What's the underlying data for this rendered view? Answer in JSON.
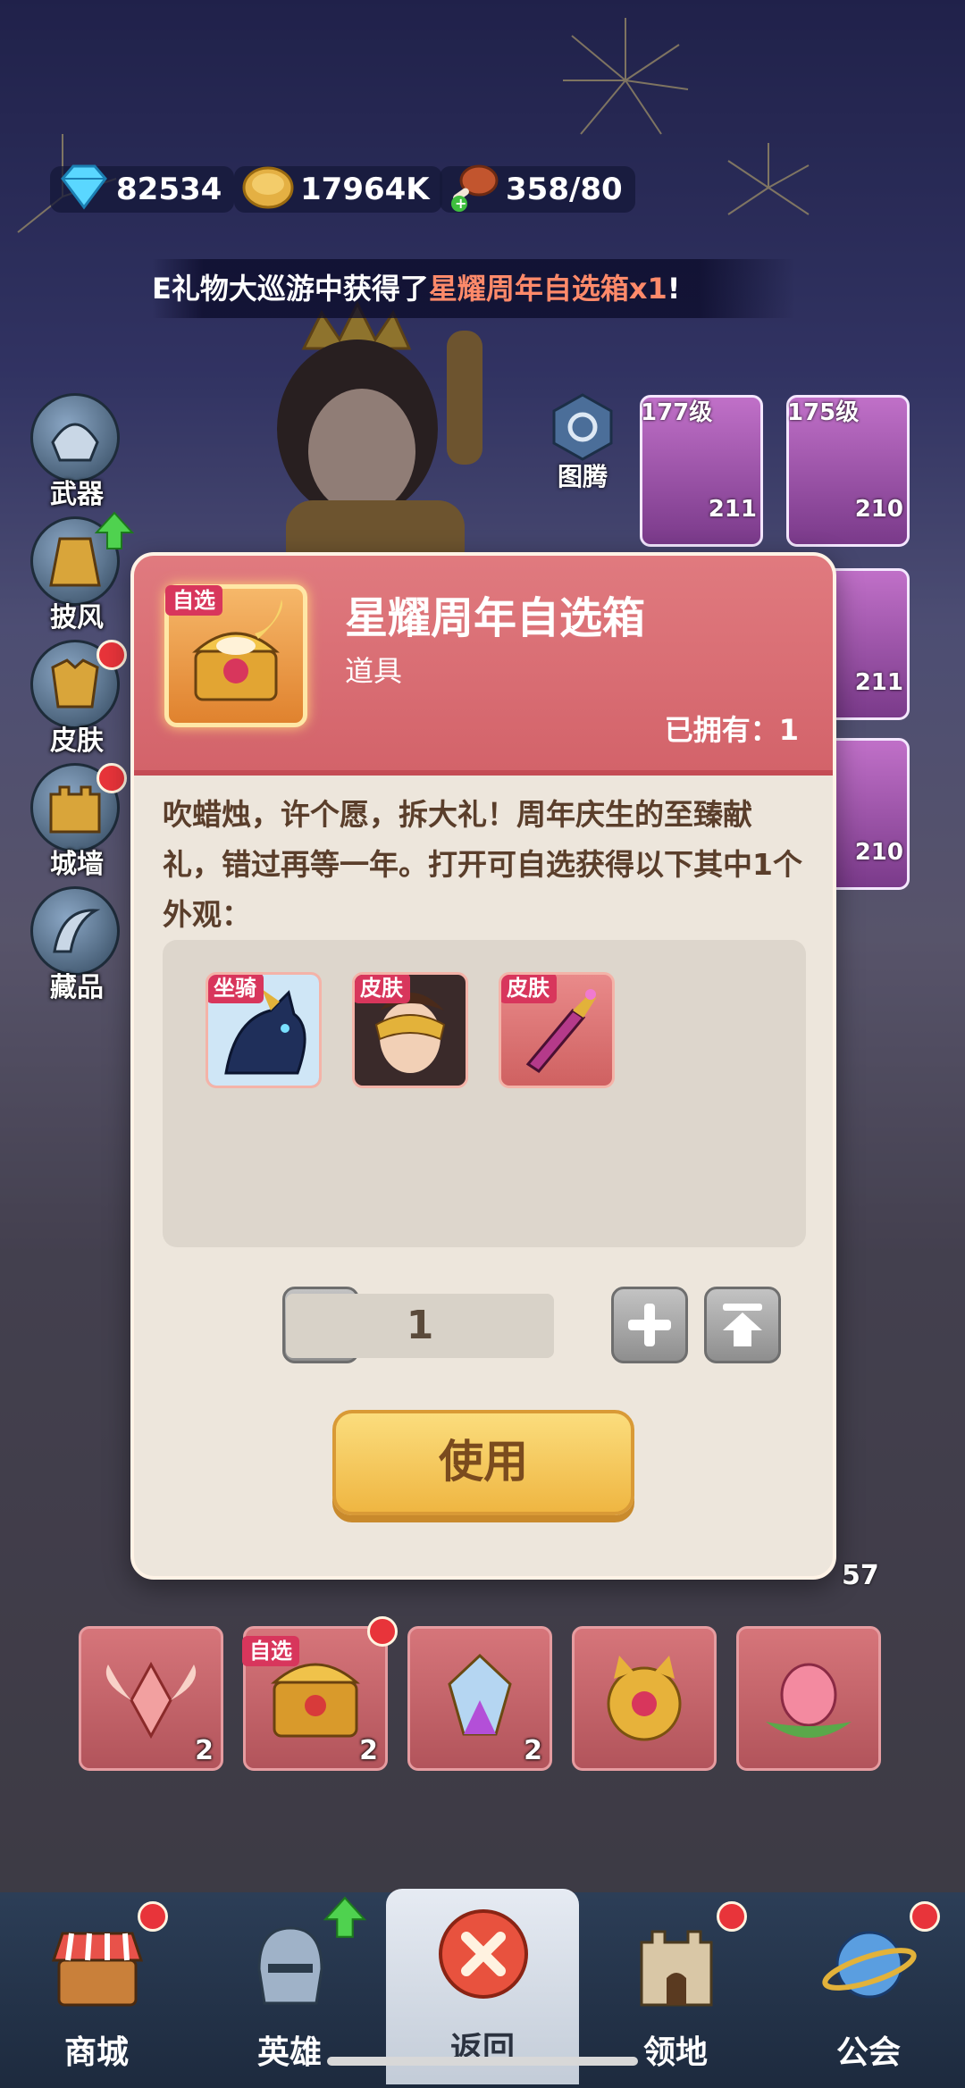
{
  "resources": {
    "gems": "82534",
    "gold": "17964K",
    "stamina": "358/80"
  },
  "banner": {
    "prefix": "E礼物大巡游中获得了",
    "highlight": "星耀周年自选箱x1",
    "suffix": "!"
  },
  "side_menu": [
    {
      "label": "武器",
      "icon": "helmet-icon"
    },
    {
      "label": "披风",
      "icon": "cape-icon"
    },
    {
      "label": "皮肤",
      "icon": "armor-icon"
    },
    {
      "label": "城墙",
      "icon": "castle-icon"
    },
    {
      "label": "藏品",
      "icon": "horn-icon"
    }
  ],
  "totem_label": "图腾",
  "hero_cards": [
    {
      "level": "177级",
      "power": "211"
    },
    {
      "level": "175级",
      "power": "210"
    },
    {
      "level": "",
      "power": "211"
    },
    {
      "level": "",
      "power": "210"
    }
  ],
  "inventory_counts": [
    "2",
    "2",
    "2",
    "57"
  ],
  "inventory_tag": "自选",
  "modal": {
    "title": "星耀周年自选箱",
    "type": "道具",
    "owned": "已拥有：1",
    "thumb_tag": "自选",
    "description": "吹蜡烛，许个愿，拆大礼！周年庆生的至臻献礼，错过再等一年。打开可自选获得以下其中1个外观：",
    "options": [
      {
        "tag": "坐骑",
        "icon": "dragon-mount-icon"
      },
      {
        "tag": "皮肤",
        "icon": "masked-hero-icon"
      },
      {
        "tag": "皮肤",
        "icon": "dagger-icon"
      }
    ],
    "quantity": "1",
    "use_label": "使用"
  },
  "nav": {
    "items": [
      {
        "label": "商城",
        "icon": "shop-icon"
      },
      {
        "label": "英雄",
        "icon": "knight-helmet-icon"
      },
      {
        "label": "返回",
        "icon": "close-icon"
      },
      {
        "label": "领地",
        "icon": "castle-tower-icon"
      },
      {
        "label": "公会",
        "icon": "planet-icon"
      }
    ]
  },
  "colors": {
    "modal_header": "#d3636a",
    "use_button": "#efb642",
    "red_dot": "#e8343a"
  }
}
